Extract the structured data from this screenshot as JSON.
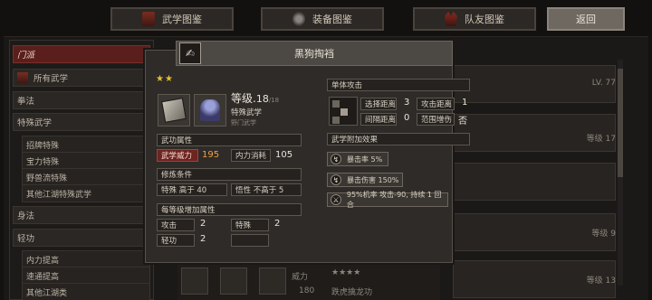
{
  "nav": {
    "tabs": [
      {
        "label": "武学图鉴",
        "icon": "book-icon"
      },
      {
        "label": "装备图鉴",
        "icon": "armor-icon"
      },
      {
        "label": "队友图鉴",
        "icon": "mask-icon"
      }
    ],
    "back_label": "返回"
  },
  "sidebar": {
    "header": "门派",
    "items": [
      "所有武学",
      "拳法",
      "特殊武学",
      "招牌特殊",
      "宝力特殊",
      "野兽流特殊",
      "其他江湖特殊武学",
      "身法",
      "轻功",
      "内力提高",
      "速通提高",
      "其他江湖类"
    ]
  },
  "background_list": {
    "labels": [
      "LV. 77",
      "等级 17",
      "等级 9",
      "等级 13"
    ]
  },
  "bottom_strip": {
    "field_label": "威力",
    "field_value": "180",
    "stars": "★★★★",
    "skill_name": "跌虎擒龙功"
  },
  "popup": {
    "title": "黑狗掏裆",
    "stars": "★★",
    "level_label": "等级.",
    "level_value": "18",
    "level_max": "/18",
    "type": "特殊武学",
    "sect": "野门武学",
    "attr_head": "武功属性",
    "power_label": "武学威力",
    "power_value": "195",
    "mp_label": "内力消耗",
    "mp_value": "105",
    "req_head": "修炼条件",
    "req1": "特殊 高于 40",
    "req2": "悟性 不高于 5",
    "growth_head": "每等级增加属性",
    "growth": [
      {
        "label": "攻击",
        "value": "2"
      },
      {
        "label": "特殊",
        "value": "2"
      },
      {
        "label": "轻功",
        "value": "2"
      },
      {
        "label": "",
        "value": ""
      }
    ],
    "attack_type": "单体攻击",
    "select_dist_label": "选择距离",
    "select_dist_value": "3",
    "attack_dist_label": "攻击距离",
    "attack_dist_value": "1",
    "gap_dist_label": "间隔距离",
    "gap_dist_value": "0",
    "aoe_label": "范围增伤",
    "aoe_value": "否",
    "effects_head": "武学附加效果",
    "effects": [
      "暴击率 5%",
      "暴击伤害 150%",
      "95%机率 攻击-90, 持续 1 回合"
    ]
  }
}
